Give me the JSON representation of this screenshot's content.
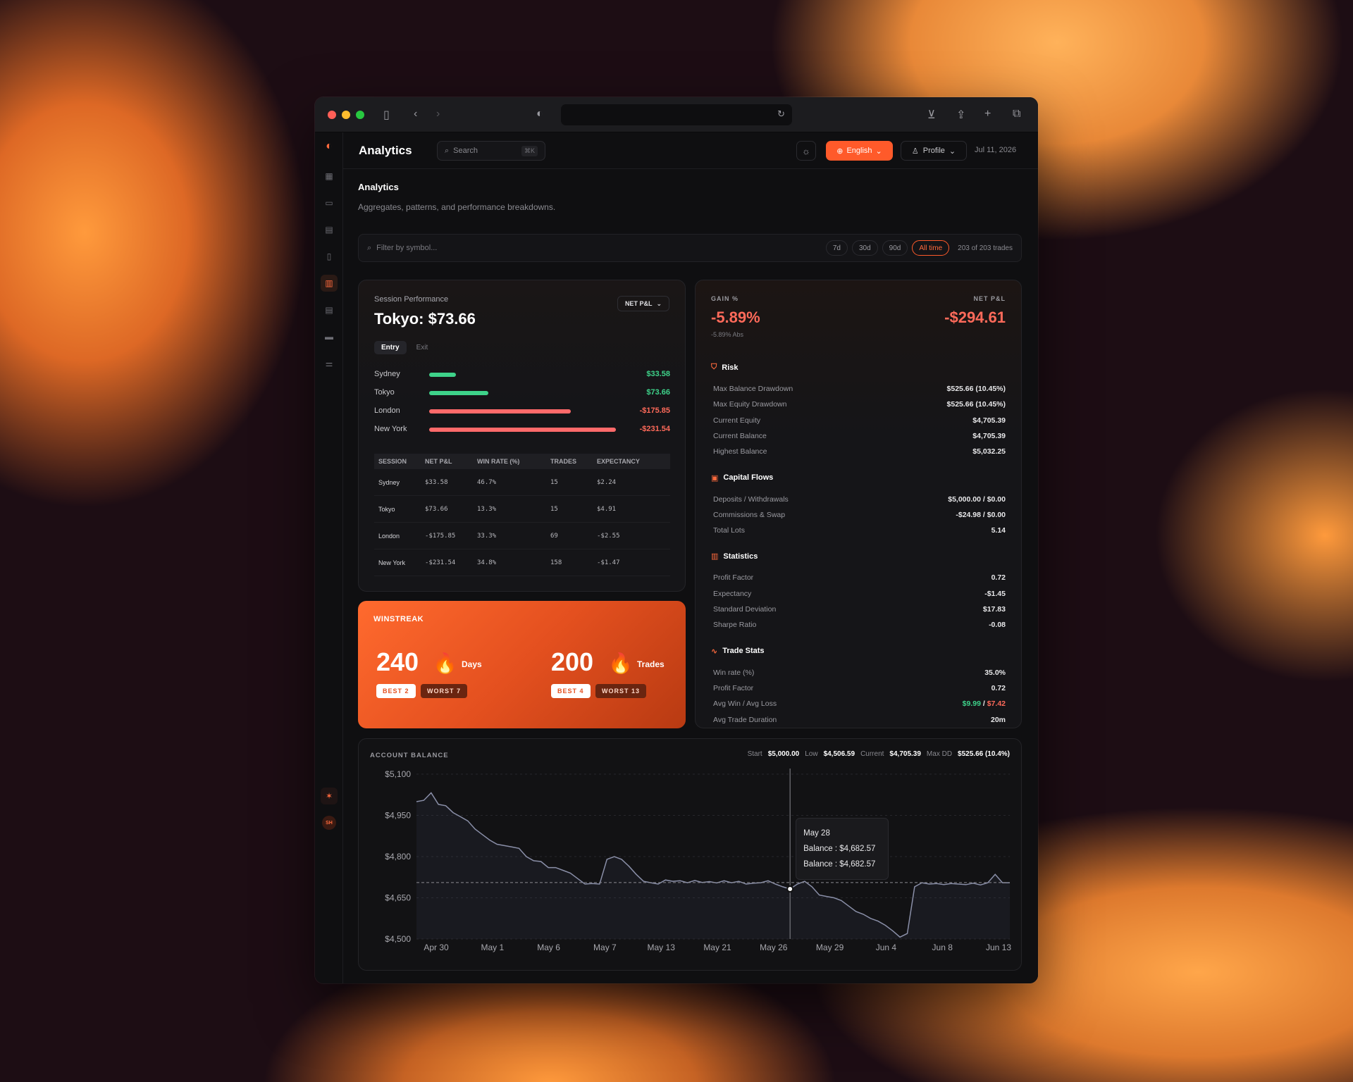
{
  "app": {
    "title": "Analytics"
  },
  "search": {
    "placeholder": "Search",
    "shortcut": "⌘K"
  },
  "topbar": {
    "language": "English",
    "profile": "Profile",
    "date": "Jul 11, 2026"
  },
  "page": {
    "title": "Analytics",
    "subtitle": "Aggregates, patterns, and performance breakdowns."
  },
  "filter": {
    "placeholder": "Filter by symbol...",
    "ranges": [
      "7d",
      "30d",
      "90d",
      "All time"
    ],
    "active_range": "All time",
    "count": "203 of 203 trades"
  },
  "session": {
    "label": "Session Performance",
    "headline": "Tokyo: $73.66",
    "metric_button": "NET P&L",
    "tabs": [
      "Entry",
      "Exit"
    ],
    "bars": [
      {
        "name": "Sydney",
        "value": 33.58,
        "display": "$33.58"
      },
      {
        "name": "Tokyo",
        "value": 73.66,
        "display": "$73.66"
      },
      {
        "name": "London",
        "value": -175.85,
        "display": "-$175.85"
      },
      {
        "name": "New York",
        "value": -231.54,
        "display": "-$231.54"
      }
    ],
    "table_headers": [
      "SESSION",
      "NET P&L",
      "WIN RATE (%)",
      "TRADES",
      "EXPECTANCY"
    ],
    "table_rows": [
      [
        "Sydney",
        "$33.58",
        "46.7%",
        "15",
        "$2.24"
      ],
      [
        "Tokyo",
        "$73.66",
        "13.3%",
        "15",
        "$4.91"
      ],
      [
        "London",
        "-$175.85",
        "33.3%",
        "69",
        "-$2.55"
      ],
      [
        "New York",
        "-$231.54",
        "34.8%",
        "158",
        "-$1.47"
      ]
    ]
  },
  "metrics": {
    "gain_label": "GAIN %",
    "gain_value": "-5.89%",
    "gain_abs": "-5.89% Abs",
    "netpl_label": "NET P&L",
    "netpl_value": "-$294.61",
    "sections": [
      {
        "title": "Risk",
        "icon": "shield-icon",
        "rows": [
          [
            "Max Balance Drawdown",
            "$525.66 (10.45%)"
          ],
          [
            "Max Equity Drawdown",
            "$525.66 (10.45%)"
          ],
          [
            "Current Equity",
            "$4,705.39"
          ],
          [
            "Current Balance",
            "$4,705.39"
          ],
          [
            "Highest Balance",
            "$5,032.25"
          ]
        ]
      },
      {
        "title": "Capital Flows",
        "icon": "wallet-icon",
        "rows": [
          [
            "Deposits / Withdrawals",
            "$5,000.00 / $0.00"
          ],
          [
            "Commissions & Swap",
            "-$24.98 / $0.00"
          ],
          [
            "Total Lots",
            "5.14"
          ]
        ]
      },
      {
        "title": "Statistics",
        "icon": "bar-chart-icon",
        "rows": [
          [
            "Profit Factor",
            "0.72"
          ],
          [
            "Expectancy",
            "-$1.45"
          ],
          [
            "Standard Deviation",
            "$17.83"
          ],
          [
            "Sharpe Ratio",
            "-0.08"
          ]
        ]
      },
      {
        "title": "Trade Stats",
        "icon": "activity-icon",
        "rows": [
          [
            "Win rate (%)",
            "35.0%"
          ],
          [
            "Profit Factor",
            "0.72"
          ],
          [
            "Avg Trade Duration",
            "20m"
          ]
        ]
      }
    ],
    "avg_win_loss": {
      "label": "Avg Win / Avg Loss",
      "win": "$9.99",
      "sep": " / ",
      "loss": "$7.42"
    }
  },
  "streak": {
    "title": "WINSTREAK",
    "days": {
      "value": "240",
      "unit": "Days",
      "best": "BEST 2",
      "worst": "WORST 7"
    },
    "trades": {
      "value": "200",
      "unit": "Trades",
      "best": "BEST 4",
      "worst": "WORST 13"
    }
  },
  "balance": {
    "title": "ACCOUNT BALANCE",
    "stats": [
      {
        "label": "Start",
        "value": "$5,000.00"
      },
      {
        "label": "Low",
        "value": "$4,506.59"
      },
      {
        "label": "Current",
        "value": "$4,705.39"
      },
      {
        "label": "Max DD",
        "value": "$525.66 (10.4%)"
      }
    ],
    "tooltip": {
      "date": "May 28",
      "line1": "Balance : $4,682.57",
      "line2": "Balance : $4,682.57"
    }
  },
  "chart_data": {
    "type": "line",
    "title": "ACCOUNT BALANCE",
    "xlabel": "",
    "ylabel": "",
    "ylim": [
      4500,
      5100
    ],
    "yticks": [
      "$5,100",
      "$4,950",
      "$4,800",
      "$4,650",
      "$4,500"
    ],
    "xticks": [
      "Apr 30",
      "May 1",
      "May 6",
      "May 7",
      "May 13",
      "May 21",
      "May 26",
      "May 29",
      "Jun 4",
      "Jun 8",
      "Jun 13"
    ],
    "grid": true,
    "reference_line": 4705.39,
    "series": [
      {
        "values": [
          5000,
          5005,
          5032,
          4990,
          4985,
          4960,
          4945,
          4930,
          4900,
          4880,
          4860,
          4845,
          4840,
          4835,
          4830,
          4800,
          4785,
          4782,
          4760,
          4760,
          4750,
          4740,
          4720,
          4700,
          4702,
          4700,
          4790,
          4800,
          4790,
          4765,
          4735,
          4710,
          4705,
          4700,
          4715,
          4710,
          4712,
          4705,
          4713,
          4706,
          4709,
          4704,
          4712,
          4705,
          4710,
          4700,
          4703,
          4705,
          4712,
          4700,
          4690,
          4682,
          4700,
          4710,
          4690,
          4660,
          4655,
          4650,
          4640,
          4620,
          4600,
          4590,
          4575,
          4565,
          4550,
          4530,
          4507,
          4520,
          4690,
          4705,
          4700,
          4702,
          4698,
          4702,
          4700,
          4698,
          4703,
          4697,
          4705,
          4735,
          4705,
          4705
        ]
      }
    ]
  }
}
